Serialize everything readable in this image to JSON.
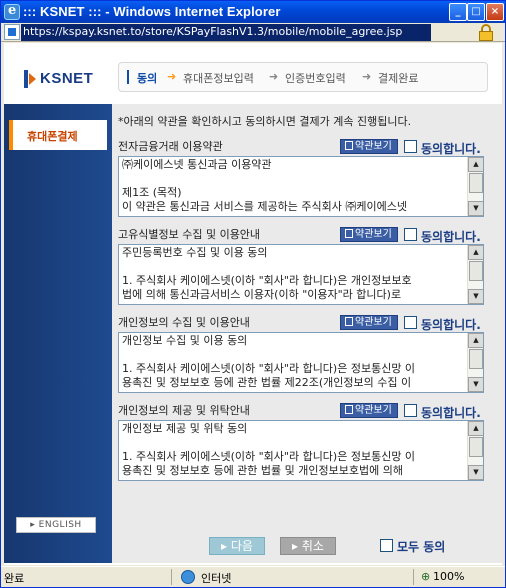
{
  "window": {
    "title": "::: KSNET ::: - Windows Internet Explorer",
    "min_label": "_",
    "max_label": "□",
    "close_label": "×"
  },
  "address": {
    "url": "https://kspay.ksnet.to/store/KSPayFlashV1.3/mobile/mobile_agree.jsp"
  },
  "logo": {
    "text": "KSNET"
  },
  "steps": [
    {
      "label": "동의",
      "active": true
    },
    {
      "label": "휴대폰정보입력"
    },
    {
      "label": "인증번호입력"
    },
    {
      "label": "결제완료"
    }
  ],
  "sidebar": {
    "active_tab": "휴대폰결제",
    "english_label": "▸ ENGLISH"
  },
  "intro": "*아래의 약관을 확인하시고 동의하시면 결제가 계속 진행됩니다.",
  "sections": [
    {
      "title": "전자금융거래 이용약관",
      "view_label": "약관보기",
      "agree_label": "동의합니다.",
      "body": "㈜케이에스넷 통신과금 이용약관\n\n제1조 (목적)\n이 약관은 통신과금 서비스를 제공하는 주식회사 ㈜케이에스넷"
    },
    {
      "title": "고유식별정보 수집 및 이용안내",
      "view_label": "약관보기",
      "agree_label": "동의합니다.",
      "body": "주민등록번호 수집 및 이용 동의\n\n1. 주식회사 케이에스넷(이하 \"회사\"라 합니다)은 개인정보보호\n법에 의해 통신과금서비스 이용자(이하 \"이용자\"라 합니다)로"
    },
    {
      "title": "개인정보의 수집 및 이용안내",
      "view_label": "약관보기",
      "agree_label": "동의합니다.",
      "body": "개인정보 수집 및 이용 동의\n\n1. 주식회사 케이에스넷(이하 \"회사\"라 합니다)은 정보통신망 이\n용촉진 및 정보보호 등에 관한 법률 제22조(개인정보의 수집 이"
    },
    {
      "title": "개인정보의 제공 및 위탁안내",
      "view_label": "약관보기",
      "agree_label": "동의합니다.",
      "body": "개인정보 제공 및 위탁 동의\n\n1. 주식회사 케이에스넷(이하 \"회사\"라 합니다)은 정보통신망 이\n용촉진 및 정보보호 등에 관한 법률 및 개인정보보호법에 의해"
    }
  ],
  "buttons": {
    "next": "▸ 다음",
    "cancel": "▸ 취소",
    "all_agree": "모두 동의"
  },
  "status": {
    "text": "완료",
    "zone": "인터넷",
    "zoom": "100%"
  }
}
